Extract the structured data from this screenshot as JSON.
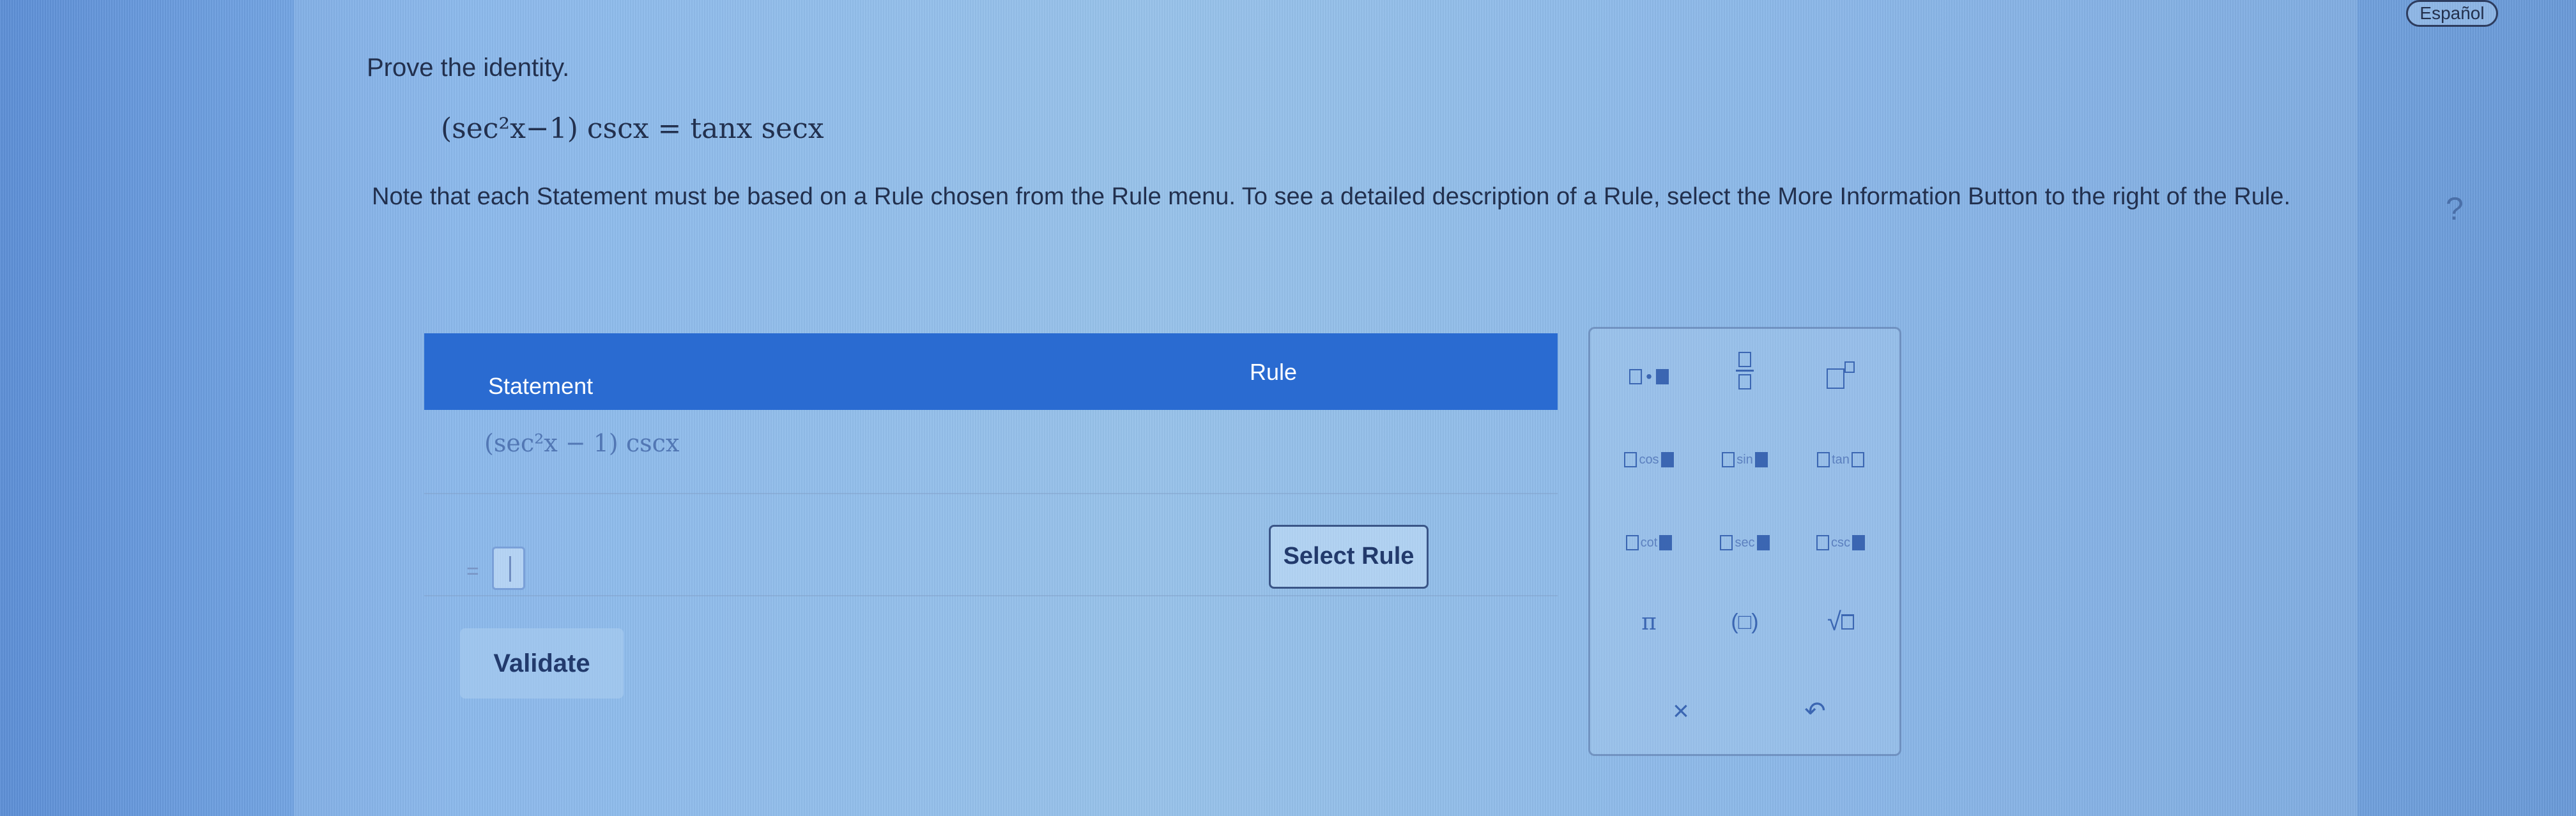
{
  "language_button": "Español",
  "help_mark": "?",
  "prompt": "Prove the identity.",
  "equation": "(sec²x−1) cscx = tanx secx",
  "note": "Note that each Statement must be based on a Rule chosen from the Rule menu. To see a detailed description of a Rule, select the More Information Button to the right of the Rule.",
  "table": {
    "header_statement": "Statement",
    "header_rule": "Rule",
    "row1_statement": "(sec²x − 1) cscx",
    "row2_equals": "=",
    "select_rule_label": "Select Rule"
  },
  "validate_label": "Validate",
  "palette": {
    "cos": "cos",
    "sin": "sin",
    "tan": "tan",
    "cot": "cot",
    "sec": "sec",
    "csc": "csc",
    "pi": "π",
    "paren": "(□)",
    "sqrt": "√",
    "clear": "×",
    "undo": "↶"
  }
}
